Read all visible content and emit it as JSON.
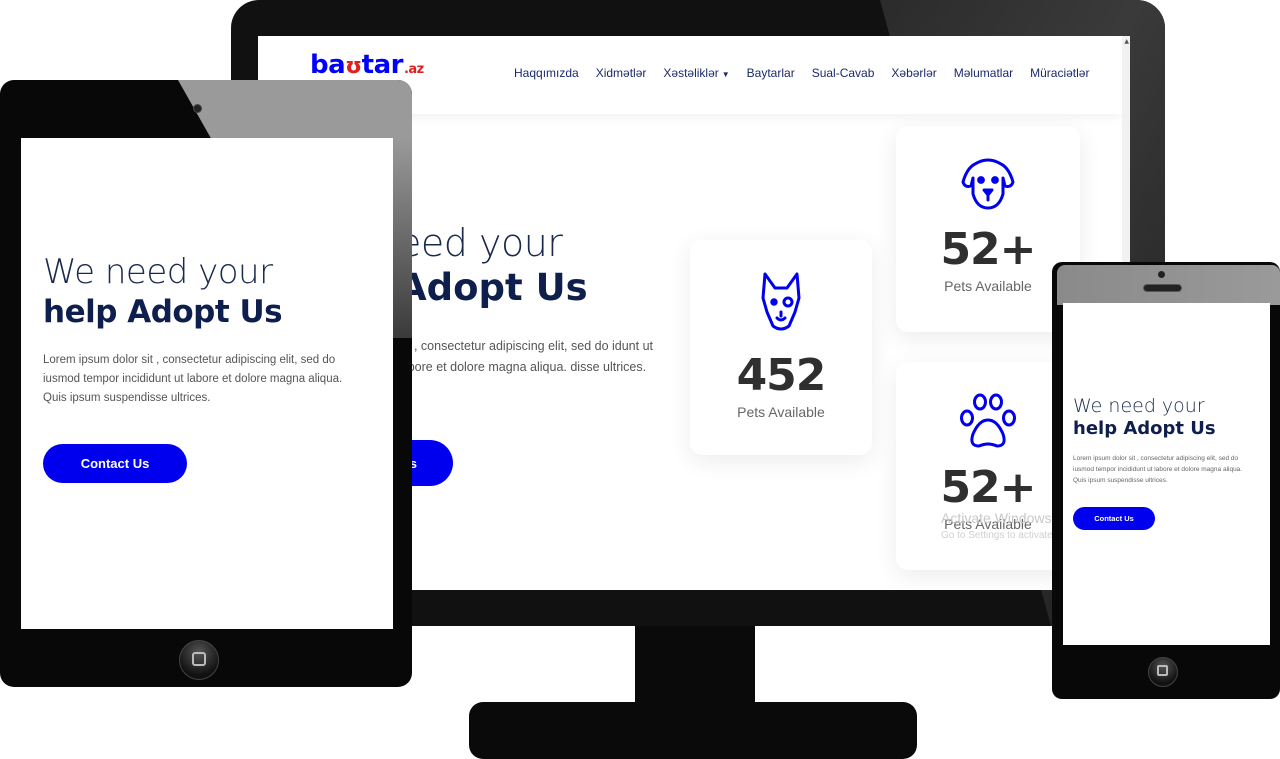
{
  "logo": {
    "text_a": "ba",
    "text_b": "ʊ",
    "text_c": "tar",
    "text_d": ".az"
  },
  "nav": {
    "items": [
      "Haqqımızda",
      "Xidmətlər",
      "Xəstəliklər",
      "Baytarlar",
      "Sual-Cavab",
      "Xəbərlər",
      "Məlumatlar",
      "Müraciətlər"
    ]
  },
  "hero": {
    "desktop_line1": "eed your",
    "desktop_line2": "Adopt Us",
    "desktop_para": "sit , consectetur adipiscing elit, sed do idunt ut labore et dolore magna aliqua. disse ultrices.",
    "desktop_button": "s",
    "line1": "We need your",
    "line2": "help Adopt Us",
    "paragraph": "Lorem ipsum dolor sit , consectetur adipiscing elit, sed do iusmod tempor incididunt ut labore et dolore magna aliqua. Quis ipsum suspendisse ultrices.",
    "button": "Contact Us"
  },
  "stats": [
    {
      "number": "452",
      "label": "Pets Available",
      "icon": "dog-icon"
    },
    {
      "number": "52+",
      "label": "Pets Available",
      "icon": "dog-face-icon"
    },
    {
      "number": "52+",
      "label": "Pets Available",
      "icon": "paw-icon"
    }
  ],
  "watermark": {
    "title": "Activate Windows",
    "subtitle": "Go to Settings to activate"
  },
  "colors": {
    "brand_blue": "#0000ee",
    "navy": "#0f1f4d",
    "logo_red": "#e02020"
  }
}
